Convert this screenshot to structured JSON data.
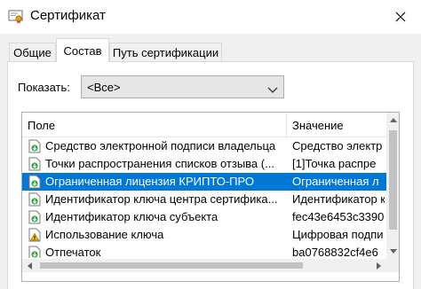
{
  "window": {
    "title": "Сертификат",
    "close_icon": "close-icon",
    "app_icon": "certificate-icon"
  },
  "tabs": [
    {
      "label": "Общие",
      "active": false
    },
    {
      "label": "Состав",
      "active": true
    },
    {
      "label": "Путь сертификации",
      "active": false
    }
  ],
  "filter": {
    "label": "Показать:",
    "selected": "<Все>"
  },
  "list": {
    "columns": [
      "Поле",
      "Значение"
    ],
    "rows": [
      {
        "field": "Средство электронной подписи владельца",
        "value": "Средство электр",
        "icon": "extension-icon",
        "selected": false
      },
      {
        "field": "Точки распространения списков отзыва (...",
        "value": "[1]Точка распре",
        "icon": "extension-icon",
        "selected": false
      },
      {
        "field": "Ограниченная лицензия КРИПТО-ПРО",
        "value": "Ограниченная л",
        "icon": "extension-icon",
        "selected": true
      },
      {
        "field": "Идентификатор ключа центра сертифика...",
        "value": "Идентификатор к",
        "icon": "extension-icon",
        "selected": false
      },
      {
        "field": "Идентификатор ключа субъекта",
        "value": "fec43e6453c3390",
        "icon": "extension-icon",
        "selected": false
      },
      {
        "field": "Использование ключа",
        "value": "Цифровая подпи",
        "icon": "warning-icon",
        "selected": false
      },
      {
        "field": "Отпечаток",
        "value": "ba0768832cf4e6",
        "icon": "extension-icon",
        "selected": false
      }
    ]
  },
  "colors": {
    "selection": "#0078d7",
    "window_bg": "#f0f0f0"
  }
}
